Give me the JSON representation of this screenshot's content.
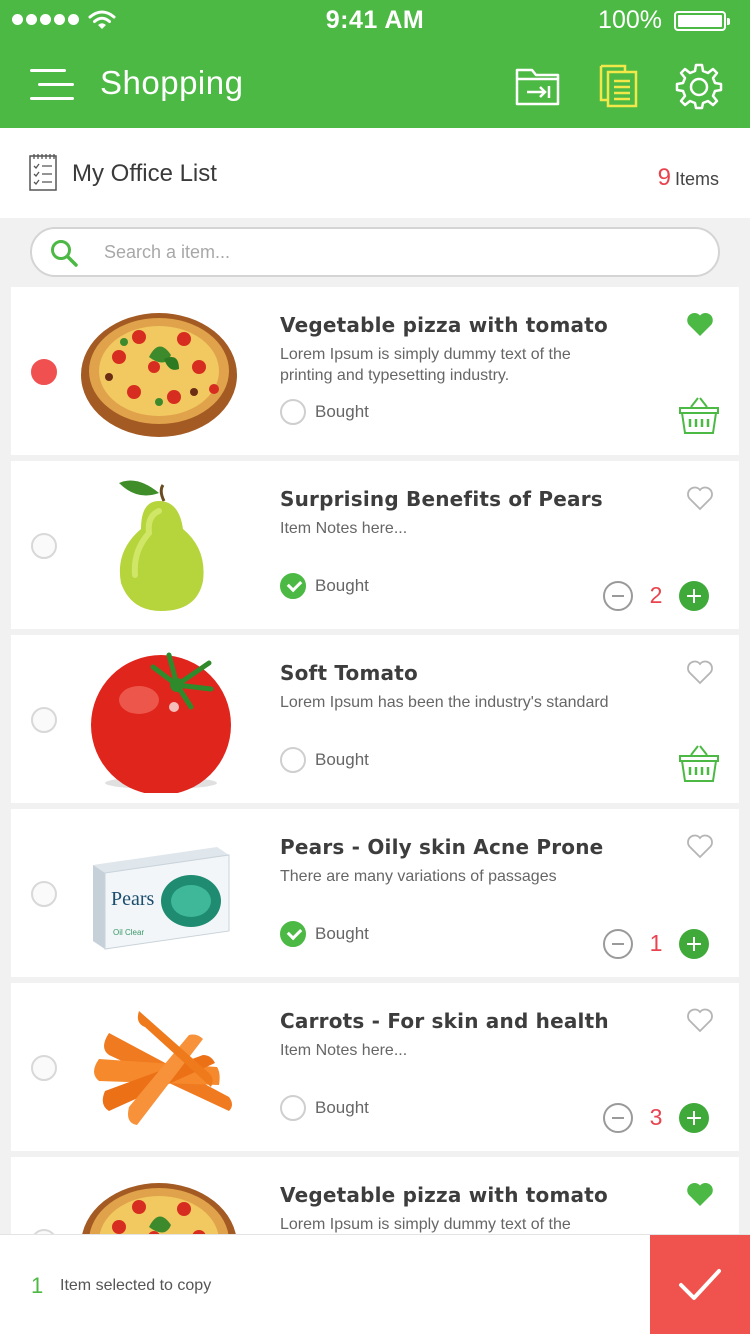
{
  "status_bar": {
    "time": "9:41 AM",
    "battery": "100%"
  },
  "header": {
    "title": "Shopping"
  },
  "list_header": {
    "title": "My Office List",
    "count": "9",
    "count_label": "Items"
  },
  "search": {
    "placeholder": "Search a item..."
  },
  "items": [
    {
      "title": "Vegetable pizza with tomato",
      "notes": "Lorem Ipsum is simply dummy text of the printing and typesetting industry.",
      "bought_label": "Bought",
      "bought": false,
      "selected": true,
      "favorite": true,
      "action": "basket",
      "image_icon": "pizza-icon"
    },
    {
      "title": "Surprising Benefits of Pears",
      "notes": "Item Notes here...",
      "bought_label": "Bought",
      "bought": true,
      "selected": false,
      "favorite": false,
      "action": "stepper",
      "qty": "2",
      "image_icon": "pear-icon"
    },
    {
      "title": "Soft Tomato",
      "notes": "Lorem Ipsum has been the industry's standard",
      "bought_label": "Bought",
      "bought": false,
      "selected": false,
      "favorite": false,
      "action": "basket",
      "image_icon": "tomato-icon"
    },
    {
      "title": "Pears - Oily skin Acne Prone",
      "notes": "There are many variations of passages",
      "bought_label": "Bought",
      "bought": true,
      "selected": false,
      "favorite": false,
      "action": "stepper",
      "qty": "1",
      "image_icon": "soap-icon",
      "product_brand": "Pears",
      "product_tag": "Oil Clear"
    },
    {
      "title": "Carrots - For skin and health",
      "notes": "Item Notes here...",
      "bought_label": "Bought",
      "bought": false,
      "selected": false,
      "favorite": false,
      "action": "stepper",
      "qty": "3",
      "image_icon": "carrot-icon"
    },
    {
      "title": "Vegetable pizza with tomato",
      "notes": "Lorem Ipsum is simply dummy text of the",
      "selected": false,
      "favorite": true,
      "image_icon": "pizza-icon"
    }
  ],
  "bottom_bar": {
    "selected_count": "1",
    "selected_label": "Item selected to copy"
  },
  "colors": {
    "primary": "#4cb944",
    "accent": "#f0534d",
    "count_red": "#e8434e",
    "highlight_yellow": "#f3e84a"
  }
}
